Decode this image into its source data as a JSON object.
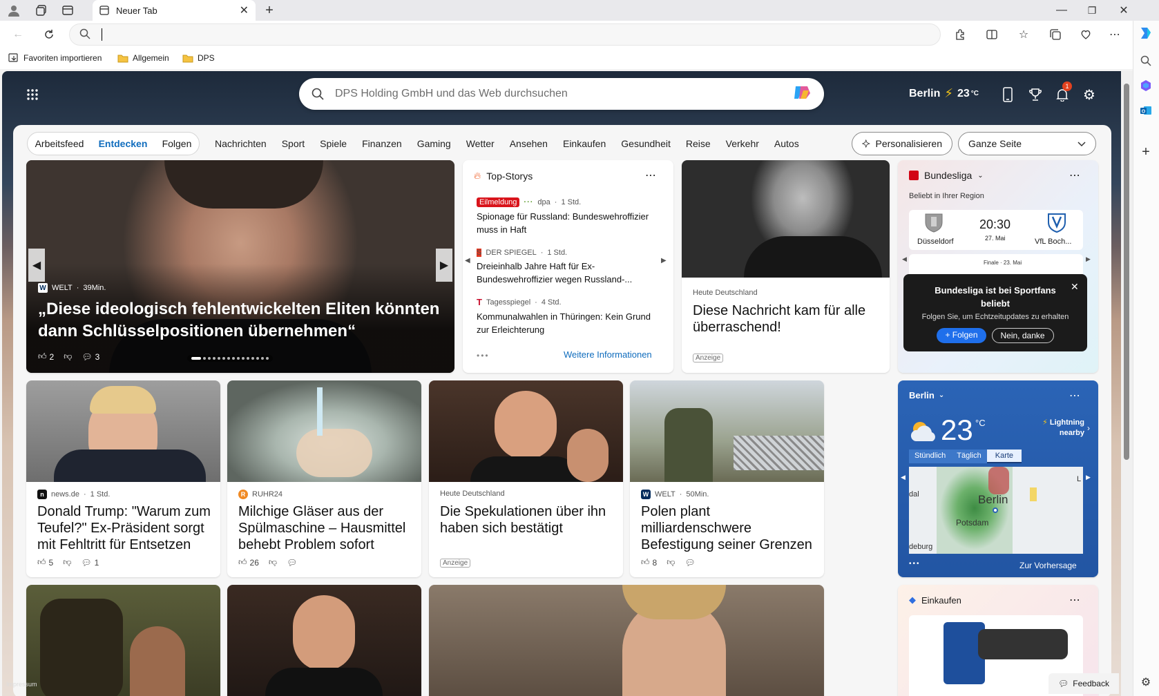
{
  "browser": {
    "tab_title": "Neuer Tab",
    "favorites": [
      "Favoriten importieren",
      "Allgemein",
      "DPS"
    ]
  },
  "header": {
    "search_placeholder": "DPS Holding GmbH und das Web durchsuchen",
    "city": "Berlin",
    "temp": "23",
    "temp_unit": "°C",
    "notification_count": "1"
  },
  "nav": {
    "pill_tabs": [
      "Arbeitsfeed",
      "Entdecken",
      "Folgen"
    ],
    "active_tab": "Entdecken",
    "categories": [
      "Nachrichten",
      "Sport",
      "Spiele",
      "Finanzen",
      "Gaming",
      "Wetter",
      "Ansehen",
      "Einkaufen",
      "Gesundheit",
      "Reise",
      "Verkehr",
      "Autos"
    ],
    "personalize": "Personalisieren",
    "layout_select": "Ganze Seite"
  },
  "hero": {
    "source": "WELT",
    "time": "39Min.",
    "title": "„Diese ideologisch fehlentwickelten Eliten könnten dann Schlüsselpositionen übernehmen“",
    "likes": "2",
    "comments": "3"
  },
  "top_stories": {
    "heading": "Top-Storys",
    "items": [
      {
        "badge": "Eilmeldung",
        "source": "dpa",
        "time": "1 Std.",
        "title": "Spionage für Russland: Bundeswehroffizier muss in Haft"
      },
      {
        "source": "DER SPIEGEL",
        "time": "1 Std.",
        "title": "Dreieinhalb Jahre Haft für Ex-Bundeswehroffizier wegen Russland-..."
      },
      {
        "source": "Tagesspiegel",
        "time": "4 Std.",
        "title": "Kommunalwahlen in Thüringen: Kein Grund zur Erleichterung"
      }
    ],
    "more": "Weitere Informationen"
  },
  "ad_card_1": {
    "source": "Heute Deutschland",
    "title": "Diese Nachricht kam für alle überraschend!",
    "ad_label": "Anzeige"
  },
  "bundesliga": {
    "heading": "Bundesliga",
    "subheading": "Beliebt in Ihrer Region",
    "match": {
      "home": "Düsseldorf",
      "time": "20:30",
      "date": "27. Mai",
      "away": "VfL Boch..."
    },
    "match2_label": "Finale · 23. Mai",
    "popup_title": "Bundesliga ist bei Sportfans beliebt",
    "popup_text": "Folgen Sie, um Echtzeitupdates zu erhalten",
    "follow": "Folgen",
    "decline": "Nein, danke"
  },
  "row2": [
    {
      "source": "news.de",
      "time": "1 Std.",
      "title": "Donald Trump: \"Warum zum Teufel?\" Ex-Präsident sorgt mit Fehltritt für Entsetzen",
      "likes": "5",
      "comments": "1"
    },
    {
      "source": "RUHR24",
      "title": "Milchige Gläser aus der Spülmaschine – Hausmittel behebt Problem sofort",
      "likes": "26"
    },
    {
      "source": "Heute Deutschland",
      "title": "Die Spekulationen über ihn haben sich bestätigt",
      "ad_label": "Anzeige"
    },
    {
      "source": "WELT",
      "time": "50Min.",
      "title": "Polen plant milliardenschwere Befestigung seiner Grenzen",
      "likes": "8"
    }
  ],
  "weather": {
    "city": "Berlin",
    "temp": "23",
    "unit": "°C",
    "alert": "Lightning nearby",
    "tabs": [
      "Stündlich",
      "Täglich",
      "Karte"
    ],
    "active_tab": "Karte",
    "map_labels": [
      "Berlin",
      "Potsdam",
      "dal",
      "deburg",
      "L"
    ],
    "forecast": "Zur Vorhersage"
  },
  "shopping": {
    "heading": "Einkaufen"
  },
  "footer": {
    "imprint": "Impressum",
    "feedback": "Feedback"
  }
}
